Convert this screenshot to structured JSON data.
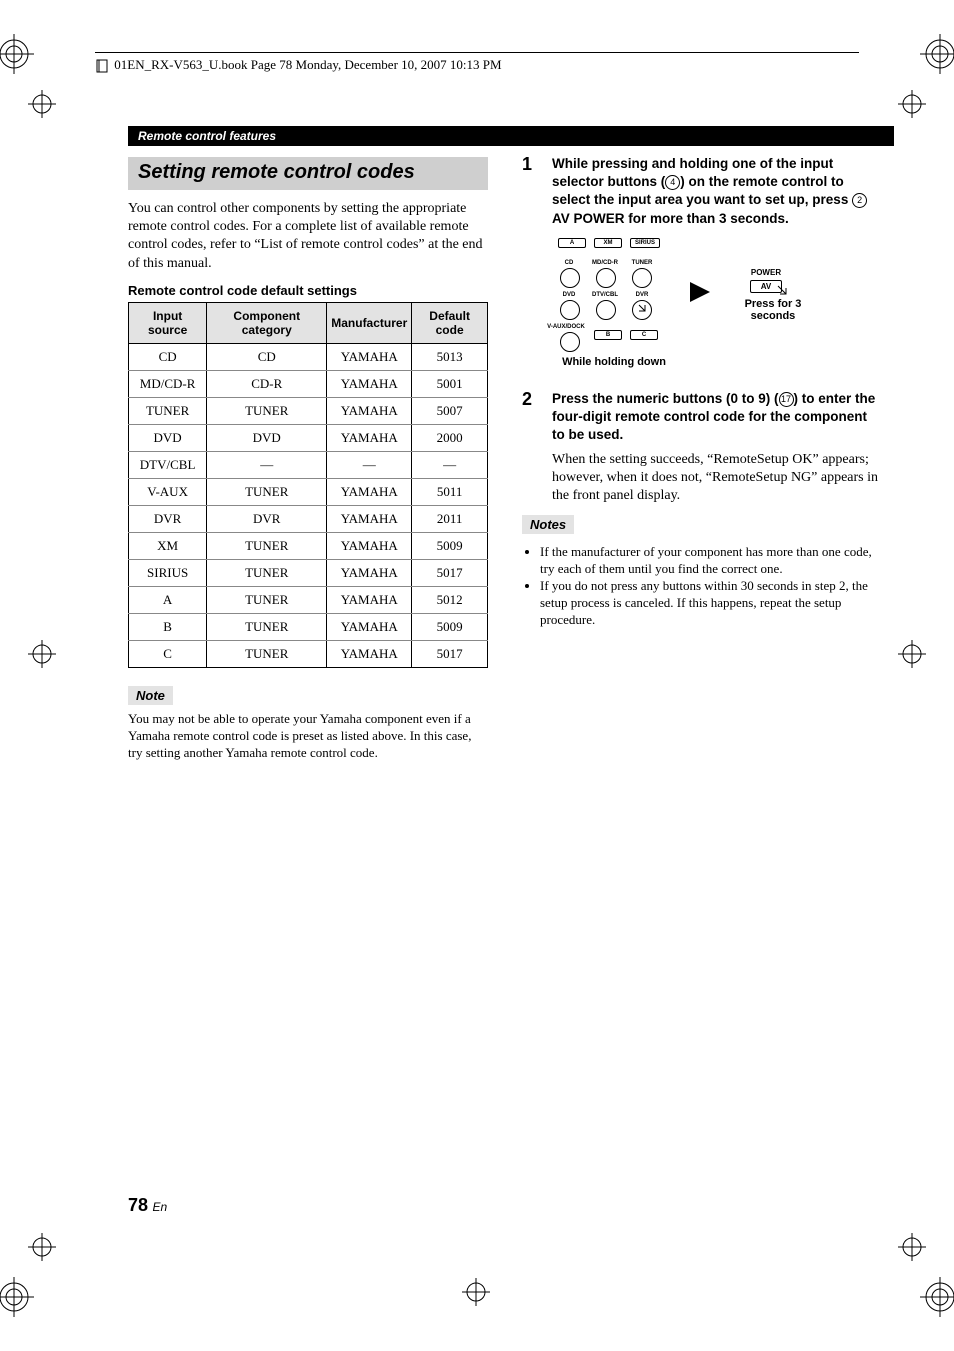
{
  "print_header": "01EN_RX-V563_U.book  Page 78  Monday, December 10, 2007  10:13 PM",
  "section_bar": "Remote control features",
  "heading": "Setting remote control codes",
  "intro": "You can control other components by setting the appropriate remote control codes. For a complete list of available remote control codes, refer to “List of remote control codes” at the end of this manual.",
  "table_title": "Remote control code default settings",
  "table_headers": [
    "Input source",
    "Component category",
    "Manufacturer",
    "Default code"
  ],
  "table_rows": [
    [
      "CD",
      "CD",
      "YAMAHA",
      "5013"
    ],
    [
      "MD/CD-R",
      "CD-R",
      "YAMAHA",
      "5001"
    ],
    [
      "TUNER",
      "TUNER",
      "YAMAHA",
      "5007"
    ],
    [
      "DVD",
      "DVD",
      "YAMAHA",
      "2000"
    ],
    [
      "DTV/CBL",
      "—",
      "—",
      "—"
    ],
    [
      "V-AUX",
      "TUNER",
      "YAMAHA",
      "5011"
    ],
    [
      "DVR",
      "DVR",
      "YAMAHA",
      "2011"
    ],
    [
      "XM",
      "TUNER",
      "YAMAHA",
      "5009"
    ],
    [
      "SIRIUS",
      "TUNER",
      "YAMAHA",
      "5017"
    ],
    [
      "A",
      "TUNER",
      "YAMAHA",
      "5012"
    ],
    [
      "B",
      "TUNER",
      "YAMAHA",
      "5009"
    ],
    [
      "C",
      "TUNER",
      "YAMAHA",
      "5017"
    ]
  ],
  "note_label": "Note",
  "note_text": "You may not be able to operate your Yamaha component even if a Yamaha remote control code is preset as listed above. In this case, try setting another Yamaha remote control code.",
  "step1": {
    "num": "1",
    "pre": "While pressing and holding one of the input selector buttons (",
    "circ1": "4",
    "mid": ") on the remote control to select the input area you want to set up, press ",
    "circ2": "2",
    "av": "AV POWER",
    "post": " for more than 3 seconds."
  },
  "diagram": {
    "row_top": [
      "A",
      "XM",
      "SIRIUS"
    ],
    "row_mid_labels": [
      "CD",
      "MD/CD-R",
      "TUNER"
    ],
    "row_low_labels": [
      "DVD",
      "DTV/CBL",
      "DVR"
    ],
    "row_bot": [
      "V-AUX/DOCK",
      "B",
      "C"
    ],
    "caption_left": "While holding down",
    "power_label": "POWER",
    "av_label": "AV",
    "caption_right": "Press for 3 seconds"
  },
  "step2": {
    "num": "2",
    "pre": "Press the numeric buttons (0 to 9) (",
    "circ": "17",
    "post": ") to enter the four-digit remote control code for the component to be used.",
    "plain": "When the setting succeeds, “RemoteSetup OK” appears; however, when it does not, “RemoteSetup NG” appears in the front panel display."
  },
  "notes_label": "Notes",
  "notes_list": [
    "If the manufacturer of your component has more than one code, try each of them until you find the correct one.",
    "If you do not press any buttons within 30 seconds in step 2, the setup process is canceled. If this happens, repeat the setup procedure."
  ],
  "page_number": "78",
  "page_lang": "En"
}
